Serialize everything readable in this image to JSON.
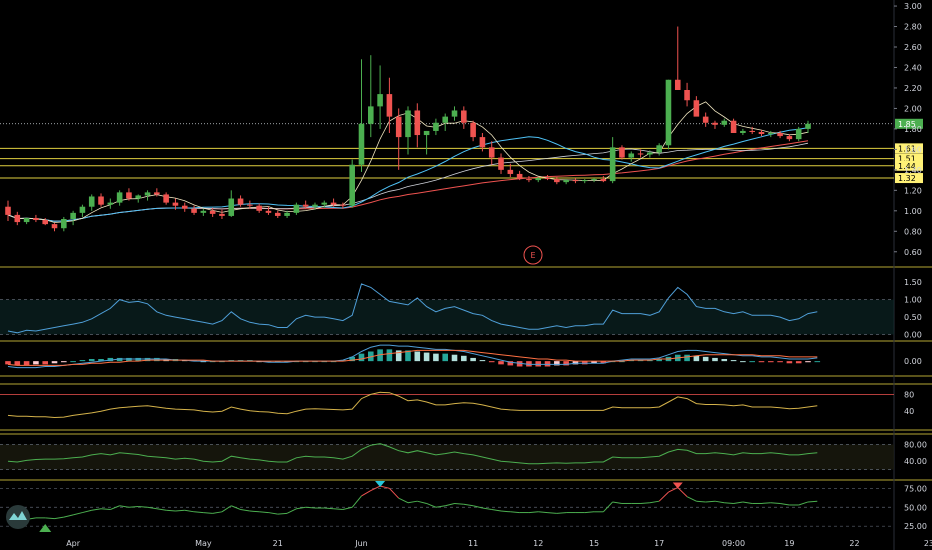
{
  "chart_data": [
    {
      "panel": "price",
      "type": "candlestick",
      "y_ticks": [
        "3.00",
        "2.80",
        "2.60",
        "2.40",
        "2.20",
        "2.00",
        "1.80",
        "1.60",
        "1.40",
        "1.20",
        "1.00",
        "0.80",
        "0.60"
      ],
      "ylim": [
        0.5,
        3.02
      ],
      "candles": [
        [
          1.04,
          1.1,
          0.9,
          0.96
        ],
        [
          0.96,
          0.99,
          0.86,
          0.89
        ],
        [
          0.89,
          0.93,
          0.87,
          0.93
        ],
        [
          0.93,
          0.96,
          0.89,
          0.91
        ],
        [
          0.91,
          0.93,
          0.86,
          0.87
        ],
        [
          0.87,
          0.88,
          0.8,
          0.83
        ],
        [
          0.83,
          0.94,
          0.8,
          0.92
        ],
        [
          0.92,
          1.0,
          0.86,
          0.98
        ],
        [
          0.98,
          1.06,
          0.94,
          1.04
        ],
        [
          1.04,
          1.16,
          1.0,
          1.14
        ],
        [
          1.14,
          1.17,
          1.04,
          1.06
        ],
        [
          1.06,
          1.12,
          1.02,
          1.08
        ],
        [
          1.08,
          1.2,
          1.05,
          1.18
        ],
        [
          1.18,
          1.22,
          1.1,
          1.12
        ],
        [
          1.12,
          1.16,
          1.08,
          1.15
        ],
        [
          1.15,
          1.2,
          1.1,
          1.18
        ],
        [
          1.18,
          1.22,
          1.14,
          1.16
        ],
        [
          1.16,
          1.18,
          1.06,
          1.08
        ],
        [
          1.08,
          1.12,
          1.01,
          1.05
        ],
        [
          1.05,
          1.08,
          0.99,
          1.02
        ],
        [
          1.02,
          1.05,
          0.96,
          0.98
        ],
        [
          0.98,
          1.02,
          0.95,
          1.0
        ],
        [
          1.0,
          1.03,
          0.94,
          0.97
        ],
        [
          0.97,
          1.01,
          0.92,
          0.95
        ],
        [
          0.95,
          1.2,
          0.94,
          1.12
        ],
        [
          1.12,
          1.15,
          1.04,
          1.06
        ],
        [
          1.06,
          1.1,
          1.02,
          1.05
        ],
        [
          1.05,
          1.07,
          0.98,
          1.0
        ],
        [
          1.0,
          1.04,
          0.96,
          0.98
        ],
        [
          0.98,
          1.0,
          0.93,
          0.95
        ],
        [
          0.95,
          1.0,
          0.93,
          0.98
        ],
        [
          0.98,
          1.08,
          0.96,
          1.06
        ],
        [
          1.06,
          1.1,
          1.02,
          1.04
        ],
        [
          1.04,
          1.08,
          1.01,
          1.06
        ],
        [
          1.06,
          1.1,
          1.03,
          1.08
        ],
        [
          1.08,
          1.12,
          1.04,
          1.06
        ],
        [
          1.06,
          1.08,
          1.02,
          1.05
        ],
        [
          1.05,
          1.5,
          1.03,
          1.45
        ],
        [
          1.45,
          2.48,
          1.38,
          1.85
        ],
        [
          1.85,
          2.52,
          1.72,
          2.02
        ],
        [
          2.02,
          2.42,
          1.8,
          2.14
        ],
        [
          2.14,
          2.3,
          1.76,
          1.92
        ],
        [
          1.92,
          2.0,
          1.4,
          1.72
        ],
        [
          1.72,
          2.02,
          1.55,
          1.98
        ],
        [
          1.98,
          2.05,
          1.62,
          1.74
        ],
        [
          1.74,
          1.78,
          1.55,
          1.78
        ],
        [
          1.78,
          1.9,
          1.74,
          1.86
        ],
        [
          1.86,
          1.95,
          1.78,
          1.92
        ],
        [
          1.92,
          2.02,
          1.88,
          1.98
        ],
        [
          1.98,
          2.02,
          1.8,
          1.86
        ],
        [
          1.86,
          1.88,
          1.68,
          1.72
        ],
        [
          1.72,
          1.76,
          1.58,
          1.62
        ],
        [
          1.62,
          1.68,
          1.45,
          1.52
        ],
        [
          1.52,
          1.56,
          1.36,
          1.4
        ],
        [
          1.4,
          1.46,
          1.33,
          1.36
        ],
        [
          1.36,
          1.39,
          1.3,
          1.31
        ],
        [
          1.31,
          1.34,
          1.28,
          1.3
        ],
        [
          1.3,
          1.33,
          1.28,
          1.32
        ],
        [
          1.32,
          1.35,
          1.3,
          1.31
        ],
        [
          1.31,
          1.33,
          1.26,
          1.28
        ],
        [
          1.28,
          1.31,
          1.26,
          1.3
        ],
        [
          1.3,
          1.32,
          1.27,
          1.29
        ],
        [
          1.29,
          1.31,
          1.27,
          1.3
        ],
        [
          1.3,
          1.32,
          1.28,
          1.31
        ],
        [
          1.31,
          1.34,
          1.28,
          1.29
        ],
        [
          1.29,
          1.72,
          1.27,
          1.62
        ],
        [
          1.62,
          1.64,
          1.5,
          1.52
        ],
        [
          1.52,
          1.58,
          1.48,
          1.56
        ],
        [
          1.56,
          1.6,
          1.52,
          1.55
        ],
        [
          1.55,
          1.59,
          1.52,
          1.57
        ],
        [
          1.57,
          1.66,
          1.54,
          1.64
        ],
        [
          1.64,
          2.28,
          1.6,
          2.28
        ],
        [
          2.28,
          2.8,
          2.2,
          2.18
        ],
        [
          2.18,
          2.25,
          2.02,
          2.08
        ],
        [
          2.08,
          2.12,
          1.96,
          1.92
        ],
        [
          1.92,
          1.96,
          1.82,
          1.86
        ],
        [
          1.86,
          1.88,
          1.8,
          1.84
        ],
        [
          1.84,
          1.9,
          1.82,
          1.88
        ],
        [
          1.88,
          1.9,
          1.76,
          1.76
        ],
        [
          1.76,
          1.8,
          1.74,
          1.78
        ],
        [
          1.78,
          1.82,
          1.75,
          1.77
        ],
        [
          1.77,
          1.79,
          1.73,
          1.75
        ],
        [
          1.75,
          1.78,
          1.72,
          1.76
        ],
        [
          1.76,
          1.78,
          1.71,
          1.73
        ],
        [
          1.73,
          1.75,
          1.68,
          1.7
        ],
        [
          1.7,
          1.82,
          1.68,
          1.8
        ],
        [
          1.8,
          1.88,
          1.76,
          1.85
        ]
      ],
      "horizontal_levels": [
        {
          "value": 1.61,
          "label": "1.61"
        },
        {
          "value": 1.51,
          "label": "1.51"
        },
        {
          "value": 1.44,
          "label": "1.44"
        },
        {
          "value": 1.32,
          "label": "1.32"
        }
      ],
      "last_price": {
        "value": 1.85,
        "label": "1.85"
      },
      "earnings_marker": "E"
    },
    {
      "panel": "indicator_1",
      "type": "line",
      "y_ticks": [
        "1.50",
        "1.00",
        "0.50",
        "0.00"
      ],
      "ylim": [
        -0.1,
        1.85
      ],
      "values": [
        0.1,
        0.05,
        0.12,
        0.1,
        0.15,
        0.2,
        0.25,
        0.3,
        0.35,
        0.45,
        0.6,
        0.75,
        1.0,
        0.92,
        0.95,
        0.88,
        0.65,
        0.55,
        0.5,
        0.45,
        0.4,
        0.35,
        0.3,
        0.4,
        0.65,
        0.45,
        0.35,
        0.3,
        0.28,
        0.2,
        0.2,
        0.45,
        0.55,
        0.5,
        0.5,
        0.45,
        0.4,
        0.55,
        1.45,
        1.35,
        1.15,
        0.95,
        0.9,
        0.85,
        1.05,
        0.8,
        0.65,
        0.75,
        0.8,
        0.7,
        0.6,
        0.55,
        0.4,
        0.3,
        0.25,
        0.2,
        0.15,
        0.15,
        0.2,
        0.25,
        0.2,
        0.25,
        0.25,
        0.3,
        0.3,
        0.7,
        0.6,
        0.6,
        0.6,
        0.55,
        0.65,
        1.05,
        1.35,
        1.15,
        0.8,
        0.75,
        0.75,
        0.65,
        0.6,
        0.65,
        0.55,
        0.55,
        0.55,
        0.5,
        0.4,
        0.45,
        0.6,
        0.65
      ]
    },
    {
      "panel": "macd",
      "type": "histogram",
      "y_ticks": [
        "0.00"
      ],
      "ylim": [
        -0.12,
        0.16
      ],
      "histogram": [
        -0.03,
        -0.04,
        -0.04,
        -0.03,
        -0.03,
        -0.02,
        -0.01,
        0.0,
        0.01,
        0.02,
        0.02,
        0.03,
        0.03,
        0.03,
        0.03,
        0.03,
        0.03,
        0.02,
        0.02,
        0.01,
        0.01,
        0.0,
        0.0,
        0.0,
        0.01,
        0.01,
        0.01,
        0.0,
        0.0,
        0.0,
        0.0,
        0.0,
        0.0,
        0.0,
        0.0,
        0.0,
        0.01,
        0.04,
        0.07,
        0.09,
        0.11,
        0.11,
        0.1,
        0.1,
        0.09,
        0.08,
        0.07,
        0.07,
        0.06,
        0.05,
        0.03,
        0.01,
        -0.01,
        -0.03,
        -0.04,
        -0.05,
        -0.05,
        -0.05,
        -0.05,
        -0.04,
        -0.04,
        -0.03,
        -0.03,
        -0.02,
        -0.02,
        0.0,
        0.0,
        0.01,
        0.01,
        0.01,
        0.02,
        0.04,
        0.06,
        0.06,
        0.05,
        0.04,
        0.03,
        0.02,
        0.01,
        0.0,
        0.0,
        -0.01,
        -0.01,
        -0.01,
        -0.02,
        -0.02,
        -0.01,
        0.0
      ],
      "macd_line": [
        -0.05,
        -0.06,
        -0.06,
        -0.06,
        -0.05,
        -0.05,
        -0.04,
        -0.03,
        -0.02,
        -0.01,
        0.0,
        0.01,
        0.02,
        0.02,
        0.02,
        0.02,
        0.02,
        0.02,
        0.01,
        0.01,
        0.0,
        0.0,
        0.0,
        0.0,
        0.0,
        0.0,
        0.0,
        0.0,
        -0.01,
        -0.01,
        -0.01,
        0.0,
        0.0,
        0.0,
        0.0,
        0.0,
        0.01,
        0.04,
        0.09,
        0.13,
        0.15,
        0.15,
        0.14,
        0.14,
        0.13,
        0.12,
        0.11,
        0.11,
        0.1,
        0.09,
        0.07,
        0.05,
        0.03,
        0.01,
        -0.01,
        -0.02,
        -0.03,
        -0.03,
        -0.03,
        -0.03,
        -0.03,
        -0.02,
        -0.02,
        -0.02,
        -0.02,
        0.0,
        0.01,
        0.02,
        0.02,
        0.02,
        0.03,
        0.06,
        0.09,
        0.1,
        0.1,
        0.09,
        0.08,
        0.07,
        0.06,
        0.05,
        0.05,
        0.04,
        0.04,
        0.03,
        0.02,
        0.02,
        0.02,
        0.03
      ],
      "signal_line": [
        -0.03,
        -0.04,
        -0.04,
        -0.04,
        -0.04,
        -0.04,
        -0.04,
        -0.03,
        -0.03,
        -0.02,
        -0.02,
        -0.01,
        -0.01,
        0.0,
        0.0,
        0.01,
        0.01,
        0.01,
        0.01,
        0.01,
        0.01,
        0.01,
        0.0,
        0.0,
        0.0,
        0.0,
        0.0,
        0.0,
        0.0,
        0.0,
        0.0,
        0.0,
        0.0,
        0.0,
        0.0,
        0.0,
        0.0,
        0.01,
        0.02,
        0.04,
        0.06,
        0.07,
        0.08,
        0.09,
        0.1,
        0.1,
        0.1,
        0.1,
        0.1,
        0.1,
        0.09,
        0.08,
        0.07,
        0.06,
        0.05,
        0.04,
        0.03,
        0.02,
        0.02,
        0.01,
        0.01,
        0.0,
        0.0,
        0.0,
        0.0,
        0.0,
        0.0,
        0.01,
        0.01,
        0.01,
        0.02,
        0.02,
        0.03,
        0.04,
        0.05,
        0.06,
        0.06,
        0.06,
        0.06,
        0.06,
        0.06,
        0.05,
        0.05,
        0.05,
        0.04,
        0.04,
        0.04,
        0.04
      ]
    },
    {
      "panel": "indicator_3",
      "type": "line",
      "y_ticks": [
        "80",
        "40"
      ],
      "ylim": [
        0,
        100
      ],
      "values": [
        30,
        28,
        28,
        27,
        27,
        25,
        26,
        30,
        33,
        36,
        40,
        45,
        48,
        50,
        52,
        53,
        50,
        47,
        45,
        44,
        43,
        40,
        38,
        40,
        50,
        45,
        41,
        39,
        38,
        35,
        34,
        40,
        45,
        46,
        45,
        44,
        43,
        45,
        70,
        80,
        85,
        84,
        76,
        65,
        67,
        62,
        55,
        55,
        58,
        60,
        59,
        55,
        50,
        45,
        43,
        42,
        42,
        42,
        42,
        42,
        42,
        42,
        42,
        42,
        42,
        50,
        48,
        48,
        48,
        48,
        50,
        62,
        74,
        70,
        58,
        56,
        56,
        55,
        53,
        55,
        50,
        50,
        50,
        48,
        46,
        47,
        50,
        53
      ]
    },
    {
      "panel": "indicator_4",
      "type": "line",
      "y_ticks": [
        "80.00",
        "40.00"
      ],
      "ylim": [
        0,
        100
      ],
      "values": [
        40,
        38,
        42,
        44,
        45,
        45,
        46,
        48,
        50,
        55,
        58,
        55,
        60,
        58,
        56,
        52,
        50,
        48,
        45,
        47,
        45,
        40,
        38,
        40,
        52,
        48,
        45,
        43,
        40,
        38,
        38,
        48,
        52,
        50,
        50,
        48,
        45,
        52,
        68,
        78,
        82,
        74,
        65,
        60,
        65,
        60,
        55,
        58,
        62,
        58,
        55,
        50,
        45,
        40,
        38,
        36,
        34,
        34,
        35,
        36,
        35,
        36,
        36,
        38,
        38,
        50,
        48,
        48,
        48,
        50,
        52,
        62,
        68,
        66,
        58,
        58,
        60,
        58,
        55,
        60,
        58,
        58,
        60,
        58,
        55,
        55,
        58,
        60
      ]
    },
    {
      "panel": "rsi",
      "type": "line",
      "y_ticks": [
        "75.00",
        "50.00",
        "25.00"
      ],
      "ylim": [
        20,
        82
      ],
      "values": [
        32,
        30,
        34,
        36,
        36,
        35,
        37,
        40,
        43,
        46,
        48,
        47,
        52,
        50,
        51,
        50,
        48,
        46,
        45,
        46,
        44,
        43,
        42,
        44,
        52,
        47,
        45,
        44,
        43,
        41,
        42,
        48,
        50,
        49,
        49,
        48,
        47,
        50,
        65,
        72,
        78,
        75,
        62,
        56,
        58,
        55,
        50,
        52,
        55,
        54,
        52,
        49,
        47,
        45,
        44,
        43,
        43,
        44,
        43,
        42,
        43,
        43,
        43,
        44,
        44,
        57,
        55,
        55,
        55,
        56,
        58,
        70,
        76,
        64,
        58,
        57,
        58,
        56,
        55,
        57,
        55,
        55,
        56,
        55,
        53,
        53,
        57,
        58
      ]
    }
  ],
  "x_axis_labels": [
    {
      "label": "Apr",
      "index": 7
    },
    {
      "label": "May",
      "index": 21
    },
    {
      "label": "21",
      "index": 29
    },
    {
      "label": "Jun",
      "index": 38
    },
    {
      "label": "11",
      "index": 50
    },
    {
      "label": "12",
      "index": 57
    },
    {
      "label": "15",
      "index": 63
    },
    {
      "label": "17",
      "index": 70
    },
    {
      "label": "09:00",
      "index": 78
    },
    {
      "label": "19",
      "index": 84
    },
    {
      "label": "22",
      "index": 91
    },
    {
      "label": "23",
      "index": 99
    }
  ],
  "colors": {
    "up": "#4caf50",
    "down": "#ef5350",
    "level_line": "#e0d040",
    "cyan": "#4fc3f7",
    "teal": "#26a69a",
    "pink": "#f48fb1",
    "red": "#ef5350",
    "gold": "#d4b24a",
    "green_line": "#4caf50",
    "blue_line": "#4f9fd8",
    "ma_white": "#d1d4dc"
  }
}
